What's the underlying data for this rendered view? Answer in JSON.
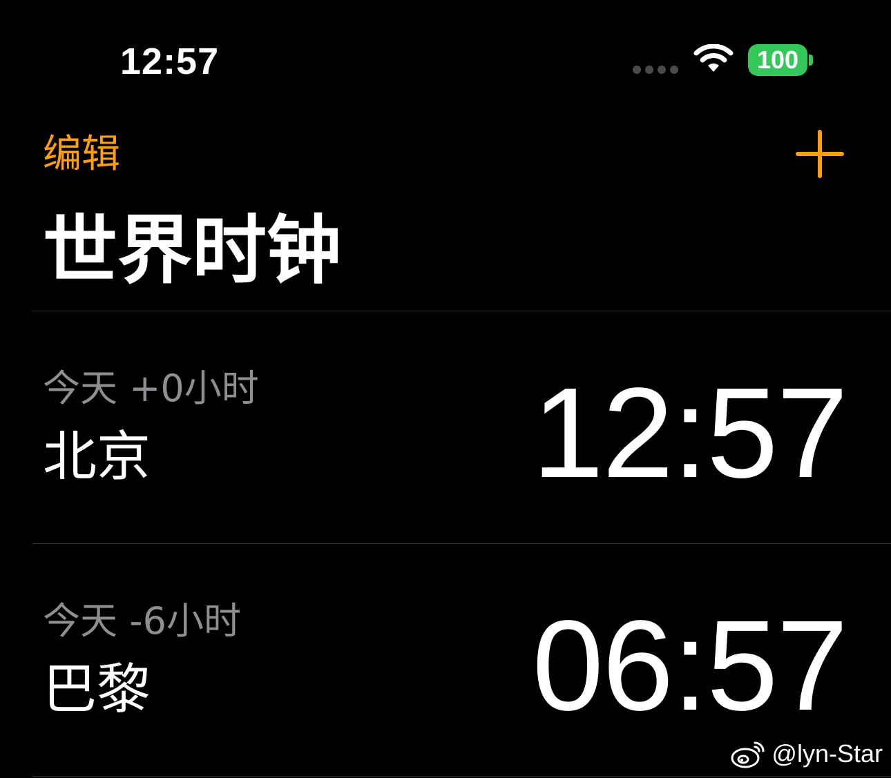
{
  "status_bar": {
    "time": "12:57",
    "battery": "100",
    "colors": {
      "battery": "#34c759"
    }
  },
  "nav": {
    "edit_label": "编辑",
    "add_icon": "plus-icon",
    "accent_color": "#ff9f0a"
  },
  "page": {
    "title": "世界时钟"
  },
  "clocks": [
    {
      "offset": "今天 +0小时",
      "city": "北京",
      "time": "12:57"
    },
    {
      "offset": "今天 -6小时",
      "city": "巴黎",
      "time": "06:57"
    }
  ],
  "watermark": {
    "icon": "weibo-icon",
    "handle": "@lyn-Star"
  }
}
